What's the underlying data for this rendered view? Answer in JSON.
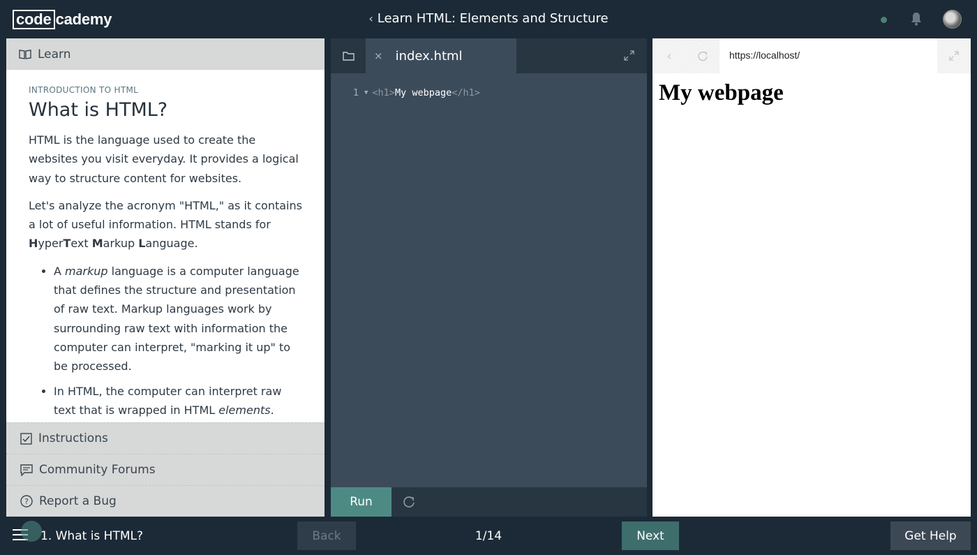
{
  "logo": {
    "boxed": "code",
    "rest": "cademy"
  },
  "header": {
    "course_title": "Learn HTML: Elements and Structure"
  },
  "left_panel": {
    "learn_label": "Learn",
    "eyebrow": "INTRODUCTION TO HTML",
    "lesson_title": "What is HTML?",
    "p1": "HTML is the language used to create the websites you visit everyday. It provides a logical way to structure content for websites.",
    "p2_a": "Let's analyze the acronym \"HTML,\" as it contains a lot of useful information. HTML stands for ",
    "p2_H": "H",
    "p2_yper": "yper",
    "p2_T": "T",
    "p2_ext": "ext ",
    "p2_M": "M",
    "p2_arkup": "arkup ",
    "p2_L": "L",
    "p2_anguage": "anguage.",
    "li1_a": "A ",
    "li1_em": "markup",
    "li1_b": " language is a computer language that defines the structure and presentation of raw text. Markup languages work by surrounding raw text with information the computer can interpret, \"marking it up\" to be processed.",
    "li2_a": "In HTML, the computer can interpret raw text that is wrapped in HTML ",
    "li2_em": "elements",
    "li2_b": ". These",
    "instructions_label": "Instructions",
    "forums_label": "Community Forums",
    "bug_label": "Report a Bug"
  },
  "editor": {
    "filename": "index.html",
    "close_glyph": "×",
    "line_number": "1",
    "code_open": "<h1>",
    "code_text": "My webpage",
    "code_close": "</h1>",
    "run_label": "Run"
  },
  "browser": {
    "url": "https://localhost/",
    "rendered_h1": "My webpage"
  },
  "footer": {
    "lesson_label": "1. What is HTML?",
    "back_label": "Back",
    "progress": "1/14",
    "next_label": "Next",
    "help_label": "Get Help"
  },
  "colors": {
    "background": "#1c2a37",
    "run_button": "#4e8a84",
    "next_button": "#3e6e6c",
    "sidebar_gray": "#d7d9d8"
  }
}
